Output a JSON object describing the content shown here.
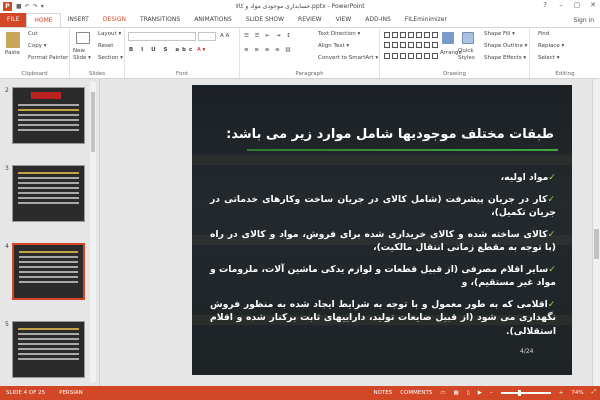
{
  "window": {
    "title": "حسابداری موجودی مواد و کالا.pptx - PowerPoint",
    "minimize": "–",
    "restore": "▢",
    "close": "✕",
    "help": "?"
  },
  "tabs": [
    "FILE",
    "HOME",
    "INSERT",
    "DESIGN",
    "TRANSITIONS",
    "ANIMATIONS",
    "SLIDE SHOW",
    "REVIEW",
    "VIEW",
    "ADD-INS",
    "FILEminimizer"
  ],
  "active_tab": "HOME",
  "signin": "Sign in",
  "ribbon": {
    "clipboard": {
      "label": "Clipboard",
      "paste": "Paste",
      "cut": "Cut",
      "copy": "Copy ▾",
      "format_painter": "Format Painter"
    },
    "slides": {
      "label": "Slides",
      "new_slide": "New Slide ▾",
      "layout": "Layout ▾",
      "reset": "Reset",
      "section": "Section ▾"
    },
    "font": {
      "label": "Font",
      "font_box": "",
      "size_box": ""
    },
    "paragraph": {
      "label": "Paragraph",
      "text_direction": "Text Direction ▾",
      "align_text": "Align Text ▾",
      "smartart": "Convert to SmartArt ▾"
    },
    "drawing": {
      "label": "Drawing",
      "arrange": "Arrange",
      "quick_styles": "Quick Styles",
      "shape_fill": "Shape Fill ▾",
      "shape_outline": "Shape Outline ▾",
      "shape_effects": "Shape Effects ▾"
    },
    "editing": {
      "label": "Editing",
      "find": "Find",
      "replace": "Replace ▾",
      "select": "Select ▾"
    }
  },
  "thumbnails": [
    {
      "num": "2",
      "selected": false
    },
    {
      "num": "3",
      "selected": false
    },
    {
      "num": "4",
      "selected": true
    },
    {
      "num": "5",
      "selected": false
    }
  ],
  "slide": {
    "title": "طبقات مختلف موجودیها شامل موارد زیر می باشد:",
    "bullets": [
      "مواد اولیه،",
      "کار در جریان پیشرفت (شامل کالای در جریان ساخت وکارهای خدماتی در جریان تکمیل)،",
      "کالای ساخته شده و کالای خریداری شده برای فروش، مواد و کالای در راه (با توجه به مقطع زمانی انتقال مالکیت)،",
      "سایر اقلام مصرفی (از قبیل قطعات و لوازم یدکی ماشین آلات، ملزومات و مواد غیر مستقیم)، و",
      "اقلامی که به طور معمول و با توجه به شرایط ایجاد شده به منظور فروش نگهداری می شود (از قبیل ضایعات تولید، داراییهای ثابت برکنار شده و اقلام استقلالی)."
    ],
    "check_mark": "✓",
    "page_number": "4/24"
  },
  "status": {
    "slide_of": "SLIDE 4 OF 25",
    "language": "PERSIAN",
    "notes": "NOTES",
    "comments": "COMMENTS",
    "zoom": "74%",
    "zoom_fraction": 0.36
  },
  "colors": {
    "accent": "#d24726",
    "check": "#9bd24a",
    "underline": "#3fa83f"
  }
}
